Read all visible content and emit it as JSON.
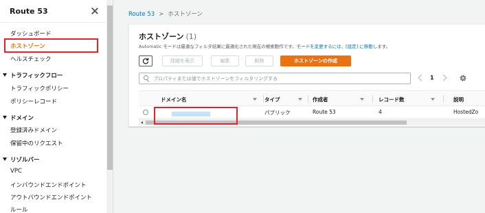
{
  "sidebar": {
    "title": "Route 53",
    "items": [
      {
        "label": "ダッシュボード"
      },
      {
        "label": "ホストゾーン"
      },
      {
        "label": "ヘルスチェック"
      }
    ],
    "sections": [
      {
        "label": "トラフィックフロー",
        "items": [
          {
            "label": "トラフィックポリシー"
          },
          {
            "label": "ポリシーレコード"
          }
        ]
      },
      {
        "label": "ドメイン",
        "items": [
          {
            "label": "登録済みドメイン"
          },
          {
            "label": "保留中のリクエスト"
          }
        ]
      },
      {
        "label": "リゾルバー",
        "items": [
          {
            "label": "VPC"
          },
          {
            "label": "インバウンドエンドポイント"
          },
          {
            "label": "アウトバウンドエンドポイント"
          },
          {
            "label": "ルール"
          }
        ]
      }
    ]
  },
  "breadcrumb": {
    "root": "Route 53",
    "separator": ">",
    "current": "ホストゾーン"
  },
  "panel": {
    "title": "ホストゾーン",
    "count": "(1)",
    "description_prefix": "Automatic モードは最適なフィルタ結果に最適化された現在の検索動作です。",
    "description_link1": "モードを変更するには、",
    "description_link2": "[設定]",
    "description_mid": " に",
    "description_link3": "移動",
    "description_suffix": "します。"
  },
  "toolbar": {
    "details_label": "詳細を表示",
    "edit_label": "編集",
    "delete_label": "削除",
    "create_label": "ホストゾーンの作成"
  },
  "search": {
    "placeholder": "プロパティまたは値でホストゾーンをフィルタリングする"
  },
  "pagination": {
    "page": "1"
  },
  "table": {
    "headers": [
      "ドメイン名",
      "タイプ",
      "作成者",
      "レコード数",
      "説明"
    ],
    "rows": [
      {
        "domain": "",
        "type": "パブリック",
        "creator": "Route 53",
        "records": "4",
        "description": "HostedZo"
      }
    ]
  },
  "colors": {
    "accent": "#ec7211",
    "link": "#0073bb",
    "annotation": "#e0212b"
  }
}
